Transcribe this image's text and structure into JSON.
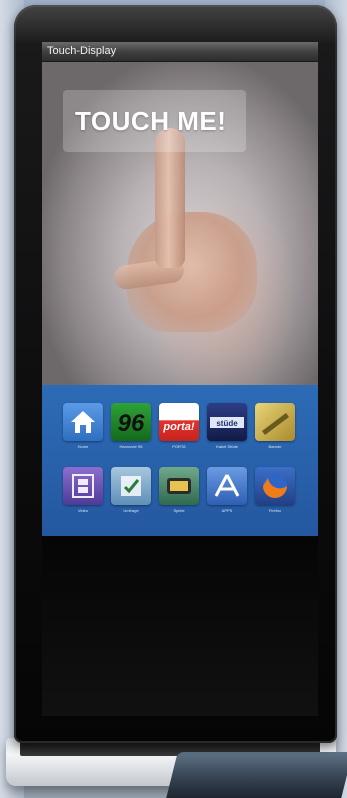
{
  "window": {
    "title": "Touch-Display"
  },
  "hero": {
    "text": "TOUCH ME!"
  },
  "apps": [
    {
      "id": "home",
      "label": "Home",
      "icon": "home-icon",
      "color": "#3d7fd1"
    },
    {
      "id": "hannover96",
      "label": "Hannover 96",
      "icon": "hannover-96-logo",
      "color": "#1f8f2a"
    },
    {
      "id": "porta",
      "label": "PORTA",
      "icon": "porta-logo",
      "color": "#e2322c"
    },
    {
      "id": "stuede",
      "label": "Kabel Stüde",
      "icon": "stuede-logo",
      "color": "#1d2c6b"
    },
    {
      "id": "banner",
      "label": "Banner",
      "icon": "banner-icon",
      "color": "#c9b048"
    },
    {
      "id": "video",
      "label": "Video",
      "icon": "film-icon",
      "color": "#6a55b4"
    },
    {
      "id": "umfrage",
      "label": "Umfrage",
      "icon": "checklist-icon",
      "color": "#7fa9c9"
    },
    {
      "id": "spiele",
      "label": "Spiele",
      "icon": "game-icon",
      "color": "#4b8a6b"
    },
    {
      "id": "appstore",
      "label": "APPS",
      "icon": "appstore-icon",
      "color": "#4a79c9"
    },
    {
      "id": "firefox",
      "label": "Firefox",
      "icon": "firefox-icon",
      "color": "#e56b1c"
    }
  ],
  "colors": {
    "panel": "#2d6bb6",
    "bezel": "#111111",
    "titlebar": "#3e3e3e"
  }
}
